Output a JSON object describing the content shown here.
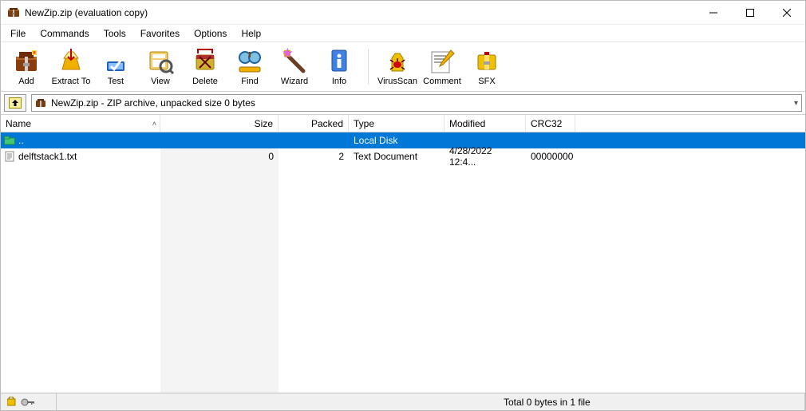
{
  "title": "NewZip.zip (evaluation copy)",
  "menus": [
    "File",
    "Commands",
    "Tools",
    "Favorites",
    "Options",
    "Help"
  ],
  "toolbar": [
    {
      "id": "add",
      "label": "Add"
    },
    {
      "id": "extract",
      "label": "Extract To"
    },
    {
      "id": "test",
      "label": "Test"
    },
    {
      "id": "view",
      "label": "View"
    },
    {
      "id": "delete",
      "label": "Delete"
    },
    {
      "id": "find",
      "label": "Find"
    },
    {
      "id": "wizard",
      "label": "Wizard"
    },
    {
      "id": "info",
      "label": "Info"
    },
    {
      "id": "virusscan",
      "label": "VirusScan"
    },
    {
      "id": "comment",
      "label": "Comment"
    },
    {
      "id": "sfx",
      "label": "SFX"
    }
  ],
  "address": "NewZip.zip - ZIP archive, unpacked size 0 bytes",
  "columns": {
    "name": "Name",
    "size": "Size",
    "packed": "Packed",
    "type": "Type",
    "modified": "Modified",
    "crc": "CRC32"
  },
  "rows": [
    {
      "name": "..",
      "size": "",
      "packed": "",
      "type": "Local Disk",
      "modified": "",
      "crc": "",
      "selected": true,
      "icon": "folder-up"
    },
    {
      "name": "delftstack1.txt",
      "size": "0",
      "packed": "2",
      "type": "Text Document",
      "modified": "4/28/2022 12:4...",
      "crc": "00000000",
      "selected": false,
      "icon": "txt"
    }
  ],
  "status": {
    "total": "Total 0 bytes in 1 file"
  }
}
